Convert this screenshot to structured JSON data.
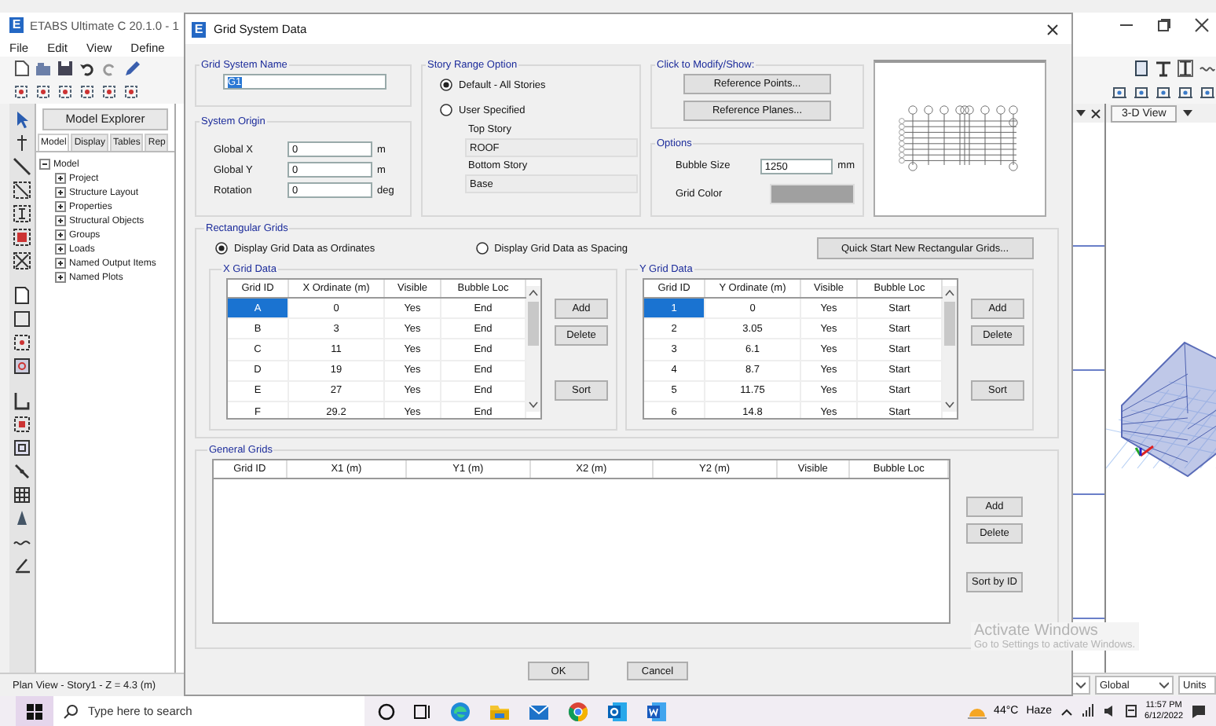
{
  "app": {
    "icon_letter": "E",
    "title": "ETABS Ultimate C 20.1.0 - 1",
    "menu": [
      "File",
      "Edit",
      "View",
      "Define"
    ],
    "explorer": {
      "title": "Model Explorer",
      "tabs": [
        {
          "label": "Model",
          "selected": true
        },
        {
          "label": "Display",
          "selected": false
        },
        {
          "label": "Tables",
          "selected": false
        },
        {
          "label": "Rep",
          "selected": false
        }
      ],
      "tree": [
        {
          "label": "Model",
          "expanded": true,
          "children": [
            {
              "label": "Project",
              "expanded": false
            },
            {
              "label": "Structure Layout",
              "expanded": false
            },
            {
              "label": "Properties",
              "expanded": false
            },
            {
              "label": "Structural Objects",
              "expanded": false
            },
            {
              "label": "Groups",
              "expanded": false
            },
            {
              "label": "Loads",
              "expanded": false
            },
            {
              "label": "Named Output Items",
              "expanded": false
            },
            {
              "label": "Named Plots",
              "expanded": false
            }
          ]
        }
      ]
    },
    "view_tab": "3-D View",
    "status": "Plan View - Story1 - Z = 4.3 (m)",
    "coordinate_system": "Global",
    "units": "Units"
  },
  "dialog": {
    "icon_letter": "E",
    "title": "Grid System Data",
    "name_group": {
      "label": "Grid System Name",
      "value": "G1",
      "value_selected": true
    },
    "origin": {
      "label": "System Origin",
      "fields": [
        {
          "label": "Global  X",
          "value": "0",
          "unit": "m"
        },
        {
          "label": "Global  Y",
          "value": "0",
          "unit": "m"
        },
        {
          "label": "Rotation",
          "value": "0",
          "unit": "deg"
        }
      ]
    },
    "story_range": {
      "label": "Story Range Option",
      "options": [
        {
          "label": "Default - All Stories",
          "selected": true
        },
        {
          "label": "User Specified",
          "selected": false
        }
      ],
      "fields": [
        {
          "label": "Top Story",
          "value": "ROOF",
          "disabled": true
        },
        {
          "label": "Bottom Story",
          "value": "Base",
          "disabled": true
        }
      ]
    },
    "modify": {
      "label": "Click to Modify/Show:",
      "buttons": [
        "Reference Points...",
        "Reference Planes..."
      ]
    },
    "options": {
      "label": "Options",
      "bubble_size": {
        "label": "Bubble Size",
        "value": "1250",
        "unit": "mm"
      },
      "grid_color": {
        "label": "Grid Color",
        "color": "#a0a0a0"
      }
    },
    "rectangular": {
      "label": "Rectangular Grids",
      "display": [
        {
          "label": "Display Grid Data as Ordinates",
          "selected": true
        },
        {
          "label": "Display Grid Data as Spacing",
          "selected": false
        }
      ],
      "quick_button": "Quick Start New Rectangular Grids...",
      "grids": [
        {
          "label": "X Grid Data",
          "columns": [
            "Grid ID",
            "X Ordinate (m)",
            "Visible",
            "Bubble Loc"
          ],
          "rows": [
            {
              "cells": [
                "A",
                "0",
                "Yes",
                "End"
              ],
              "selected": true
            },
            {
              "cells": [
                "B",
                "3",
                "Yes",
                "End"
              ],
              "selected": false
            },
            {
              "cells": [
                "C",
                "11",
                "Yes",
                "End"
              ],
              "selected": false
            },
            {
              "cells": [
                "D",
                "19",
                "Yes",
                "End"
              ],
              "selected": false
            },
            {
              "cells": [
                "E",
                "27",
                "Yes",
                "End"
              ],
              "selected": false
            },
            {
              "cells": [
                "F",
                "29.2",
                "Yes",
                "End"
              ],
              "selected": false
            }
          ],
          "buttons": [
            "Add",
            "Delete",
            "Sort"
          ]
        },
        {
          "label": "Y Grid Data",
          "columns": [
            "Grid ID",
            "Y Ordinate (m)",
            "Visible",
            "Bubble Loc"
          ],
          "rows": [
            {
              "cells": [
                "1",
                "0",
                "Yes",
                "Start"
              ],
              "selected": true
            },
            {
              "cells": [
                "2",
                "3.05",
                "Yes",
                "Start"
              ],
              "selected": false
            },
            {
              "cells": [
                "3",
                "6.1",
                "Yes",
                "Start"
              ],
              "selected": false
            },
            {
              "cells": [
                "4",
                "8.7",
                "Yes",
                "Start"
              ],
              "selected": false
            },
            {
              "cells": [
                "5",
                "11.75",
                "Yes",
                "Start"
              ],
              "selected": false
            },
            {
              "cells": [
                "6",
                "14.8",
                "Yes",
                "Start"
              ],
              "selected": false
            }
          ],
          "buttons": [
            "Add",
            "Delete",
            "Sort"
          ]
        }
      ]
    },
    "general": {
      "label": "General Grids",
      "columns": [
        "Grid ID",
        "X1 (m)",
        "Y1 (m)",
        "X2 (m)",
        "Y2 (m)",
        "Visible",
        "Bubble Loc"
      ],
      "buttons": [
        "Add",
        "Delete",
        "Sort by ID"
      ]
    },
    "footer_buttons": [
      "OK",
      "Cancel"
    ]
  },
  "activation_notice": {
    "title": "Activate Windows",
    "subtitle": "Go to Settings to activate Windows."
  },
  "taskbar": {
    "search_placeholder": "Type here to search",
    "temperature": "44°C",
    "weather": "Haze",
    "time": "11:57 PM",
    "date": "6/12/2022"
  }
}
